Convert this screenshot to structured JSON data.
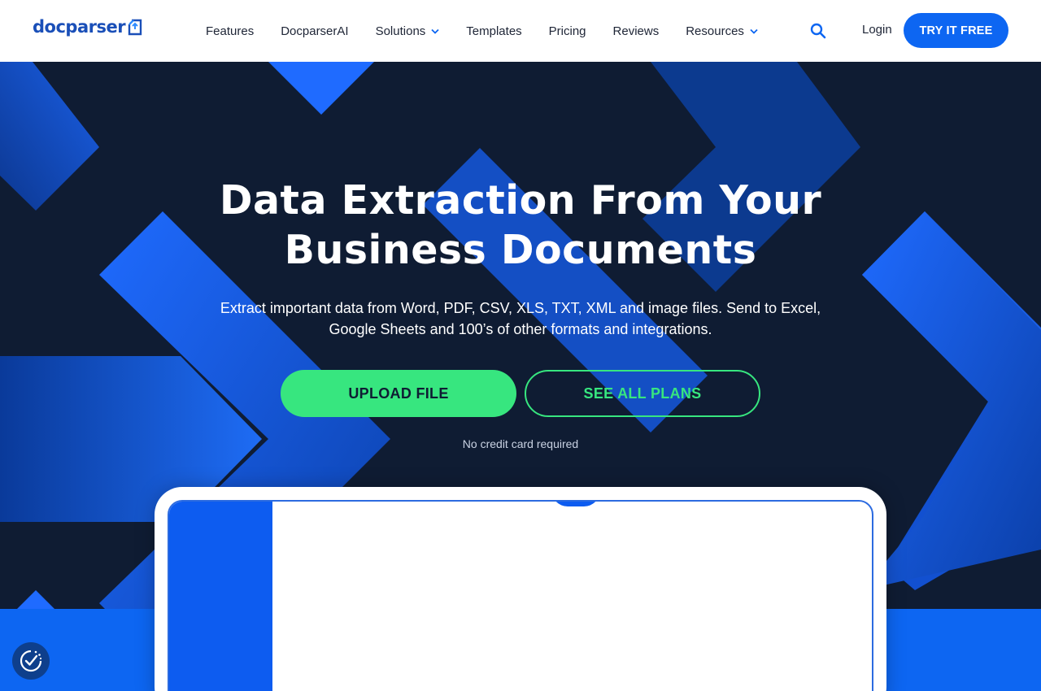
{
  "header": {
    "logo_text": "docparser",
    "nav": [
      {
        "label": "Features",
        "dropdown": false
      },
      {
        "label": "DocparserAI",
        "dropdown": false
      },
      {
        "label": "Solutions",
        "dropdown": true
      },
      {
        "label": "Templates",
        "dropdown": false
      },
      {
        "label": "Pricing",
        "dropdown": false
      },
      {
        "label": "Reviews",
        "dropdown": false
      },
      {
        "label": "Resources",
        "dropdown": true
      }
    ],
    "search_icon": "search-icon",
    "login_label": "Login",
    "cta_label": "TRY IT FREE"
  },
  "hero": {
    "title_line1": "Data Extraction From Your",
    "title_line2": "Business Documents",
    "subtitle_line1": "Extract important data from Word, PDF, CSV, XLS, TXT, XML and image files. Send to Excel,",
    "subtitle_line2": "Google Sheets and 100’s of other formats and integrations.",
    "upload_label": "UPLOAD FILE",
    "plans_label": "SEE ALL PLANS",
    "note": "No credit card required"
  },
  "colors": {
    "brand_blue": "#0d66f2",
    "hero_bg": "#0f1c33",
    "accent_green": "#37e67f",
    "logo_blue": "#1a4fb8"
  },
  "widgets": {
    "consent_icon": "cookie-consent-icon"
  }
}
